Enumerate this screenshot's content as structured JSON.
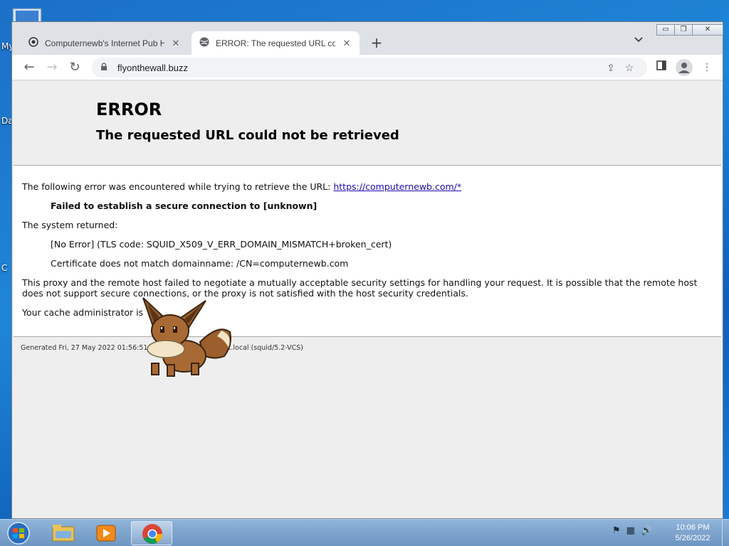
{
  "desktop": {
    "fragments": [
      "My",
      "Da",
      "C"
    ]
  },
  "browser": {
    "tabs": [
      {
        "title": "Computernewb's Internet Pub Hub",
        "active": false,
        "icon": "tab-site-icon"
      },
      {
        "title": "ERROR: The requested URL could not be retrieved",
        "active": true,
        "icon": "globe-icon"
      }
    ],
    "new_tab_symbol": "+",
    "tab_menu_symbol": "⌄",
    "window_controls": {
      "minimize": "▭",
      "restore": "❐",
      "close": "✕"
    },
    "nav": {
      "back": "←",
      "forward": "→",
      "reload": "↻"
    },
    "address": "flyonthewall.buzz"
  },
  "page": {
    "title": "ERROR",
    "subtitle": "The requested URL could not be retrieved",
    "intro_text": "The following error was encountered while trying to retrieve the URL: ",
    "intro_link": "https://computernewb.com/*",
    "failure": "Failed to establish a secure connection to [unknown]",
    "system_returned_label": "The system returned:",
    "system_error": "[No Error] (TLS code: SQUID_X509_V_ERR_DOMAIN_MISMATCH+broken_cert)",
    "cert_detail": "Certificate does not match domainname: /CN=computernewb.com",
    "explanation": "This proxy and the remote host failed to negotiate a mutually acceptable security settings for handling your request. It is possible that the remote host does not support secure connections, or the proxy is not satisfied with the host security credentials.",
    "admin_text": "Your cache administrator is",
    "footer": "Generated Fri, 27 May 2022 01:56:51 GMT by router.collabnet.local (squid/5.2-VCS)"
  },
  "taskbar": {
    "apps": [
      "explorer",
      "media-player",
      "chrome"
    ],
    "clock_time": "10:06 PM",
    "clock_date": "5/26/2022"
  },
  "colors": {
    "link": "#1a0dab",
    "page_bg": "#eeeeee",
    "taskbar": "#7ea6d0"
  }
}
